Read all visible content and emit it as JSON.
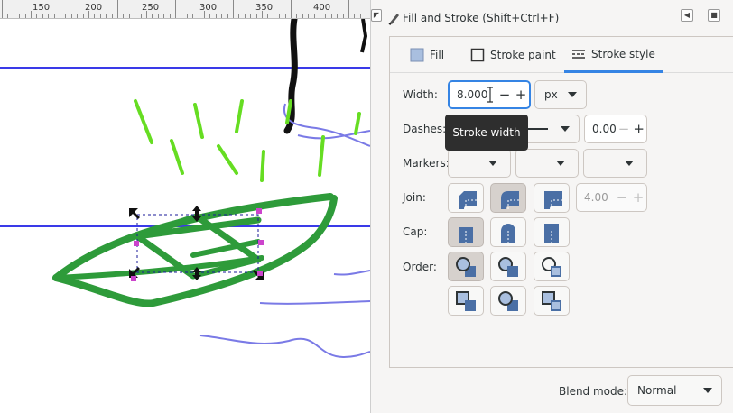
{
  "ruler": {
    "labels": [
      "150",
      "200",
      "250",
      "300",
      "350",
      "400"
    ]
  },
  "panel": {
    "title": "Fill and Stroke (Shift+Ctrl+F)",
    "tabs": [
      {
        "label": "Fill",
        "icon": "fill-icon"
      },
      {
        "label": "Stroke paint",
        "icon": "stroke-paint-icon"
      },
      {
        "label": "Stroke style",
        "icon": "stroke-style-icon",
        "active": true
      }
    ],
    "width": {
      "label": "Width:",
      "value": "8.000",
      "unit": "px",
      "minus": "−",
      "plus": "+"
    },
    "dashes": {
      "label": "Dashes:",
      "offset": "0.00",
      "minus": "−",
      "plus": "+"
    },
    "markers": {
      "label": "Markers:"
    },
    "join": {
      "label": "Join:",
      "miter_limit": "4.00",
      "minus": "−",
      "plus": "+"
    },
    "cap": {
      "label": "Cap:"
    },
    "order": {
      "label": "Order:"
    },
    "blend": {
      "label": "Blend mode:",
      "value": "Normal"
    }
  },
  "tooltip": {
    "text": "Stroke width"
  },
  "colors": {
    "accent": "#3584e4",
    "boat": "#2e9b3a",
    "grass": "#66dd22",
    "guide": "#3a3ae8",
    "wave": "#7a7ae6",
    "handle": "#cc44cc"
  }
}
